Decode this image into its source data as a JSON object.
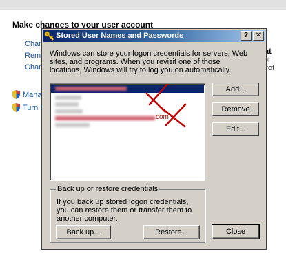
{
  "background": {
    "heading": "Make changes to your user account",
    "links": [
      "Chang",
      "Remo",
      "Chang"
    ],
    "shield_links": [
      "Mana",
      "Turn U"
    ],
    "right_fragment": {
      "bold": "strat",
      "line2": "rator",
      "line3": "d prot"
    }
  },
  "dialog": {
    "title": "Stored User Names and Passwords",
    "help_label": "?",
    "close_label": "✕",
    "intro": "Windows can store your logon credentials for servers, Web sites, and programs. When you revisit one of those locations, Windows will try to log you on automatically.",
    "buttons": {
      "add": "Add...",
      "remove": "Remove",
      "edit": "Edit...",
      "close": "Close"
    },
    "backup_group": {
      "legend": "Back up or restore credentials",
      "text": "If you back up stored logon credentials, you can restore them or transfer them to another computer.",
      "backup": "Back up...",
      "restore": "Restore..."
    },
    "credentials_tail": "com"
  },
  "colors": {
    "selection": "#0a246a",
    "redaction": "#cc0000",
    "dialog_face": "#d4d0c8"
  }
}
